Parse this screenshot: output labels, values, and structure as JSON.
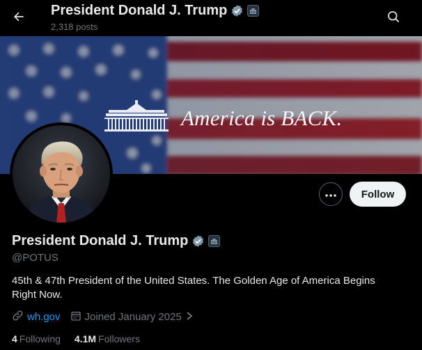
{
  "header": {
    "title": "President Donald J. Trump",
    "post_count": "2,318 posts"
  },
  "banner": {
    "slogan": "America is BACK."
  },
  "actions": {
    "follow_label": "Follow"
  },
  "profile": {
    "name": "President Donald J. Trump",
    "handle": "@POTUS",
    "bio": "45th & 47th President of the United States. The Golden Age of America Begins Right Now.",
    "website": "wh.gov",
    "joined": "Joined January 2025",
    "following_count": "4",
    "following_label": "Following",
    "followers_count": "4.1M",
    "followers_label": "Followers"
  },
  "icons": [
    "back-arrow-icon",
    "search-icon",
    "verified-badge-icon",
    "affiliate-badge-icon",
    "more-icon",
    "link-icon",
    "calendar-icon",
    "chevron-right-icon"
  ],
  "colors": {
    "background": "#000000",
    "text": "#e7e9ea",
    "muted": "#71767b",
    "link": "#1d9bf0",
    "verified_badge": "#829aab",
    "follow_button": "#eff3f4"
  }
}
